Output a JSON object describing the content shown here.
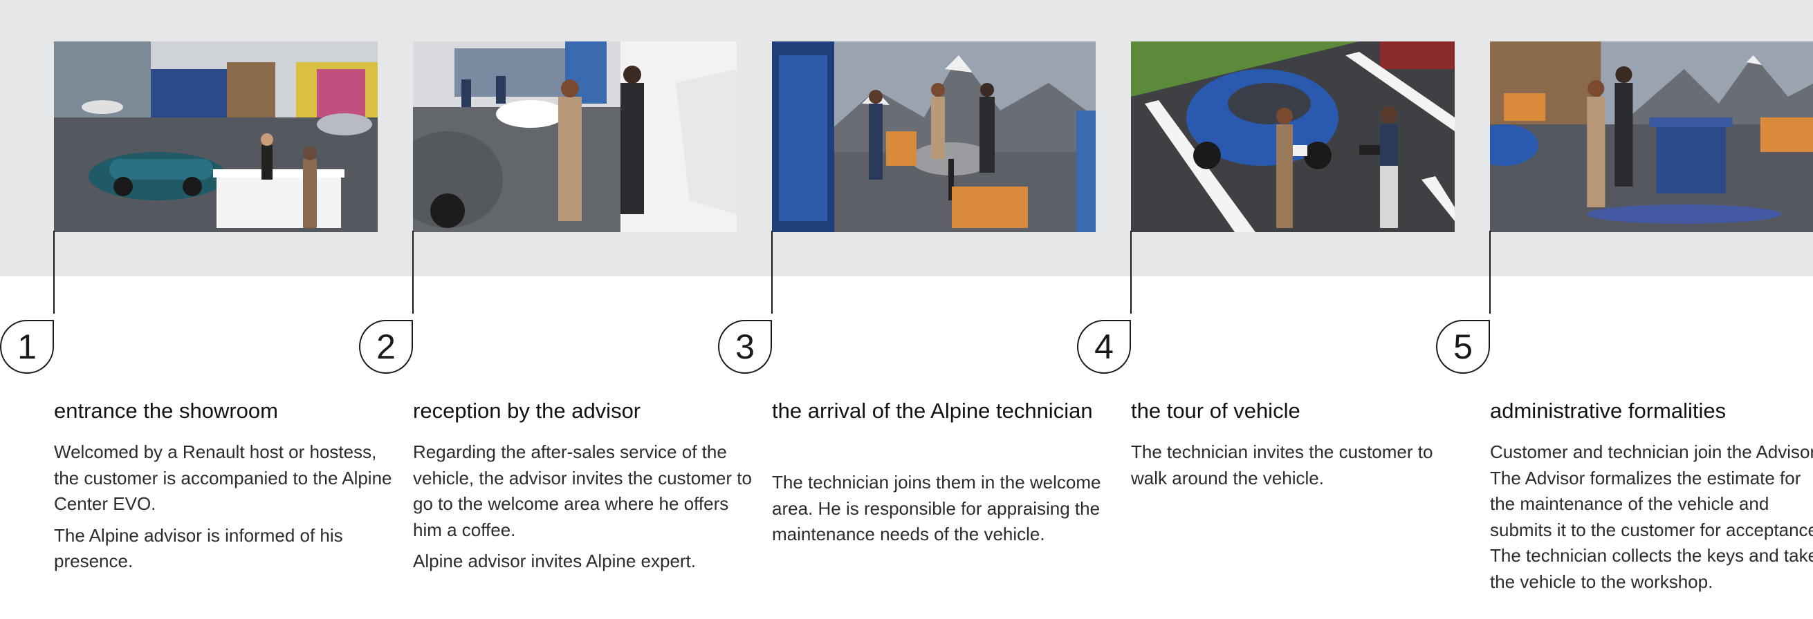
{
  "steps": [
    {
      "number": "1",
      "title": "entrance the showroom",
      "paragraphs": [
        "Welcomed by a Renault host or hostess, the customer is accompanied to the Alpine Center EVO.",
        "The Alpine advisor is informed of his presence."
      ]
    },
    {
      "number": "2",
      "title": "reception by the advisor",
      "paragraphs": [
        "Regarding the after-sales service of the vehicle, the advisor invites the customer to go to the welcome area where he offers him a coffee.",
        "Alpine advisor invites Alpine expert."
      ]
    },
    {
      "number": "3",
      "title": "the arrival of the Alpine technician",
      "paragraphs": [
        "The technician joins them in the welcome area. He is responsible for appraising the maintenance needs of the vehicle."
      ]
    },
    {
      "number": "4",
      "title": "the tour of vehicle",
      "paragraphs": [
        "The technician invites the customer to walk around the vehicle."
      ]
    },
    {
      "number": "5",
      "title": "administrative formalities",
      "paragraphs": [
        "Customer and technician join the Advisor. The Advisor formalizes the estimate for the maintenance of the vehicle and submits it to the customer for acceptance. The technician collects the keys and takes the vehicle to the workshop."
      ]
    }
  ],
  "colors": {
    "band": "#e6e7e9",
    "ink": "#1a1a1a",
    "body_text": "#2c2c2c"
  }
}
